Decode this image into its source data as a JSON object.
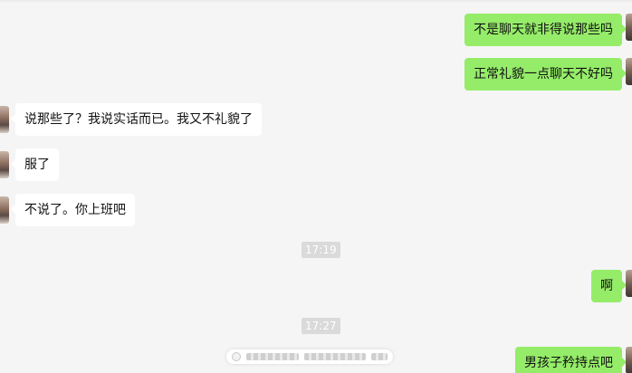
{
  "messages": {
    "m1": "不是聊天就非得说那些吗",
    "m2": "正常礼貌一点聊天不好吗",
    "m3": "说那些了？我说实话而已。我又不礼貌了",
    "m4": "服了",
    "m5": "不说了。你上班吧",
    "m6": "啊",
    "m7": "男孩子矜持点吧"
  },
  "timestamps": {
    "t1": "17:19",
    "t2": "17:27"
  },
  "colors": {
    "outgoing_bubble": "#95ec69",
    "incoming_bubble": "#ffffff",
    "background": "#f5f5f5"
  }
}
